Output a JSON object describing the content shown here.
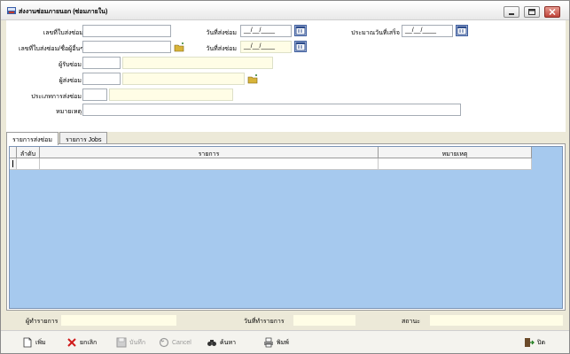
{
  "window": {
    "title": "ส่งงานซ่อมภายนอก (ซ่อมภายใน)"
  },
  "form": {
    "doc_no_label": "เลขที่ใบส่งซ่อม",
    "doc_no_value": "",
    "send_date_label": "วันที่ส่งซ่อม",
    "send_date_value": "__/__/____",
    "estimate_date_label": "ประมาณวันที่เสร็จ",
    "estimate_date_value": "__/__/____",
    "ref_no_label": "เลขที่ใบส่งซ่อม/ชื่อผู้อื่นๆ",
    "ref_no_value": "",
    "send_date2_label": "วันที่ส่งซ่อม",
    "send_date2_value": "__/__/____",
    "receiver_label": "ผู้รับซ่อม",
    "receiver_code": "",
    "receiver_name": "",
    "sender_label": "ผู้ส่งซ่อม",
    "sender_code": "",
    "sender_name": "",
    "repair_type_label": "ประเภทการส่งซ่อม",
    "repair_type_code": "",
    "repair_type_name": "",
    "remark_label": "หมายเหตุ",
    "remark_value": ""
  },
  "tabs": [
    {
      "label": "รายการส่งซ่อม",
      "active": true
    },
    {
      "label": "รายการ Jobs",
      "active": false
    }
  ],
  "grid": {
    "columns": [
      "ลำดับ",
      "รายการ",
      "หมายเหตุ"
    ]
  },
  "status": {
    "operator_label": "ผู้ทำรายการ",
    "operator_value": "",
    "trans_date_label": "วันที่ทำรายการ",
    "trans_date_value": "",
    "state_label": "สถานะ",
    "state_value": ""
  },
  "toolbar": {
    "add": "เพิ่ม",
    "cancel_doc": "ยกเลิก",
    "save": "บันทึก",
    "cancel": "Cancel",
    "search": "ค้นหา",
    "print": "พิมพ์",
    "close": "ปิด"
  },
  "colors": {
    "grid_background": "#a6c9ee",
    "readonly_field": "#fffde6",
    "window_background": "#ece9d8"
  }
}
